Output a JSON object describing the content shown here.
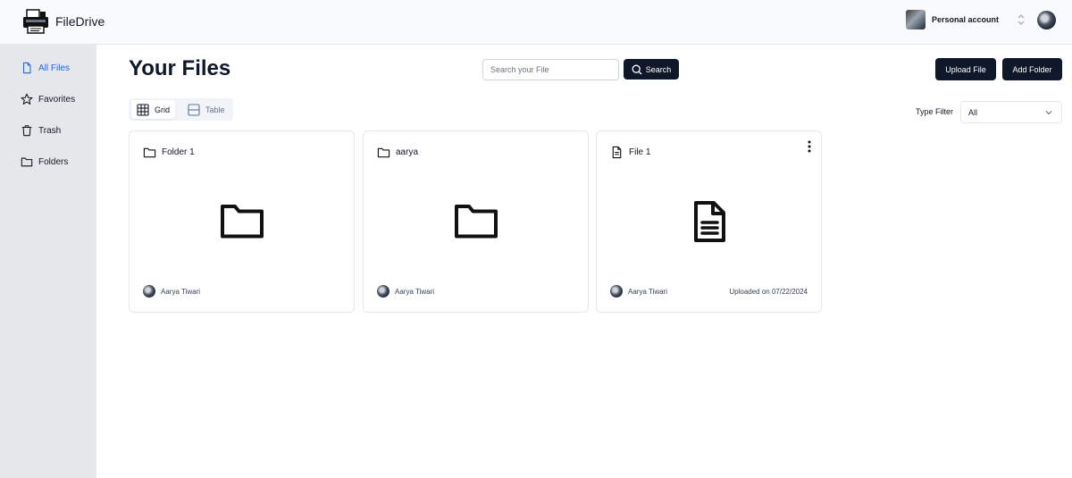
{
  "header": {
    "app_name": "FileDrive",
    "account_name": "Personal account",
    "icons": {
      "logo": "printer-logo-icon",
      "switcher": "chevrons-up-down-icon"
    }
  },
  "sidebar": {
    "items": [
      {
        "label": "All Files",
        "icon": "file-icon",
        "active": true
      },
      {
        "label": "Favorites",
        "icon": "star-icon",
        "active": false
      },
      {
        "label": "Trash",
        "icon": "trash-icon",
        "active": false
      },
      {
        "label": "Folders",
        "icon": "folder-icon",
        "active": false
      }
    ]
  },
  "main": {
    "title": "Your Files",
    "search": {
      "placeholder": "Search your File",
      "value": "",
      "button_label": "Search"
    },
    "actions": {
      "upload_label": "Upload File",
      "add_folder_label": "Add Folder"
    },
    "view_toggle": {
      "grid_label": "Grid",
      "table_label": "Table",
      "selected": "Grid"
    },
    "type_filter": {
      "label": "Type Filter",
      "selected": "All"
    },
    "cards": [
      {
        "name": "Folder 1",
        "type": "folder",
        "owner": "Aarya Tiwari",
        "uploaded": ""
      },
      {
        "name": "aarya",
        "type": "folder",
        "owner": "Aarya Tiwari",
        "uploaded": ""
      },
      {
        "name": "File 1",
        "type": "file",
        "owner": "Aarya Tiwari",
        "uploaded": "Uploaded on 07/22/2024"
      }
    ]
  },
  "colors": {
    "primary": "#0f172a",
    "active_link": "#2563eb",
    "sidebar_bg": "#e5e7eb",
    "header_bg": "#f9fafb"
  }
}
